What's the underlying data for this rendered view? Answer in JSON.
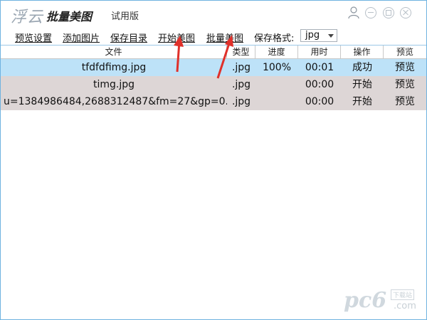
{
  "titlebar": {
    "logo_text": "浮云",
    "app_name": "批量美图",
    "edition": "试用版"
  },
  "toolbar": {
    "items": [
      "预览设置",
      "添加图片",
      "保存目录",
      "开始美图",
      "批量美图"
    ],
    "format_label": "保存格式:",
    "format_value": "jpg"
  },
  "table": {
    "headers": [
      "文件",
      "类型",
      "进度",
      "用时",
      "操作",
      "预览"
    ],
    "rows": [
      {
        "file": "tfdfdfimg.jpg",
        "type": ".jpg",
        "progress": "100%",
        "time": "00:01",
        "op": "成功",
        "preview": "预览"
      },
      {
        "file": "timg.jpg",
        "type": ".jpg",
        "progress": "",
        "time": "00:00",
        "op": "开始",
        "preview": "预览"
      },
      {
        "file": "u=1384986484,2688312487&fm=27&gp=0.j...",
        "type": ".jpg",
        "progress": "",
        "time": "00:00",
        "op": "开始",
        "preview": "预览"
      }
    ]
  },
  "watermark": {
    "brand": "pc6",
    "tag": "下载站",
    "suffix": ".com"
  },
  "colors": {
    "selected_row": "#bde2f8",
    "normal_row": "#ddd6d6",
    "border": "#6fb2e0",
    "annotation_arrow": "#e0302a"
  },
  "icons": [
    "user-icon",
    "minimize-icon",
    "maximize-icon",
    "close-icon",
    "dropdown-arrow-icon"
  ]
}
